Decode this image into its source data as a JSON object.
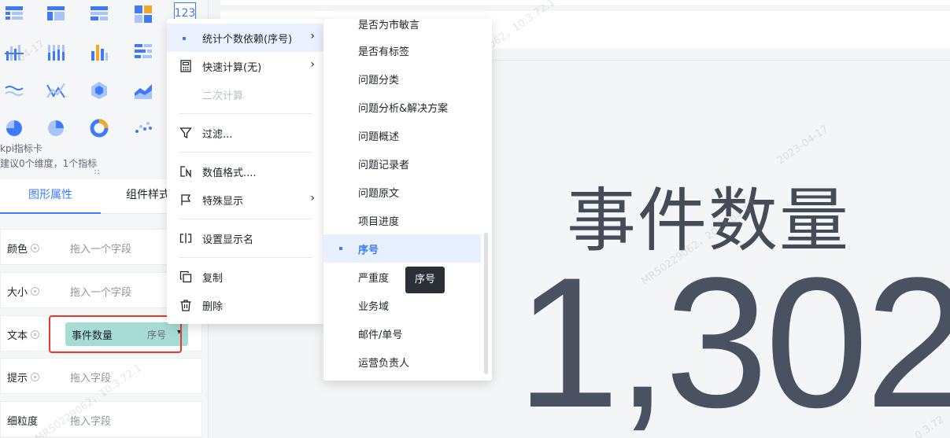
{
  "chart_picker": {
    "selected_number_label": "123",
    "selected_name": "kpi指标卡",
    "hint": "建议0个维度，1个指标",
    "drag_handle": "∷"
  },
  "tabs": {
    "graphic_properties": "图形属性",
    "component_style": "组件样式"
  },
  "properties": {
    "color_label": "颜色",
    "color_placeholder": "拖入一个字段",
    "size_label": "大小",
    "size_placeholder": "拖入一个字段",
    "text_label": "文本",
    "text_field_name": "事件数量",
    "text_field_sub": "序号",
    "text_field_caret": "▾",
    "tip_label": "提示",
    "tip_placeholder": "拖入字段",
    "granularity_label": "细粒度",
    "granularity_placeholder": "拖入字段"
  },
  "context_menu": {
    "count_dependency": "统计个数依赖(序号)",
    "quick_calc": "快速计算(无)",
    "secondary_calc": "二次计算",
    "filter": "过滤...",
    "number_format": "数值格式....",
    "special_display": "特殊显示",
    "set_display_name": "设置显示名",
    "copy": "复制",
    "delete": "删除",
    "arrow": "›"
  },
  "submenu": {
    "items": [
      "是否为市敏言",
      "是否有标签",
      "问题分类",
      "问题分析&解决方案",
      "问题概述",
      "问题记录者",
      "问题原文",
      "项目进度",
      "序号",
      "严重度",
      "业务域",
      "邮件/单号",
      "运营负责人"
    ],
    "selected": "序号"
  },
  "tooltip": "序号",
  "kpi": {
    "title": "事件数量",
    "value": "1,302"
  },
  "watermark": {
    "a": "MR50229062，10.3.72.1",
    "b": "2023-04-17",
    "c": "MR50229062，2023-04-17",
    "d": "04-17",
    "e": "0.3.72"
  },
  "colors": {
    "accent": "#3e7bfa",
    "pill": "#a7dcd4",
    "highlight_box": "#e8382f",
    "kpi_text": "#4a5261"
  }
}
